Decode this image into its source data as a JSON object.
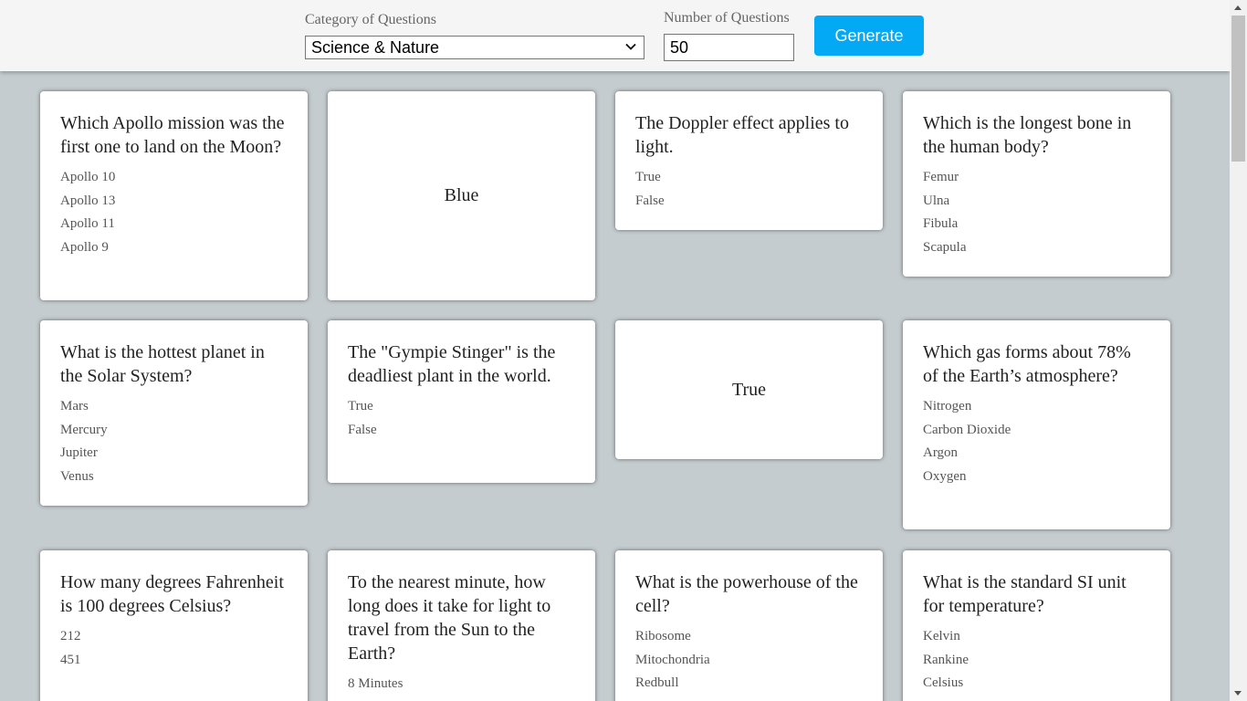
{
  "header": {
    "category_label": "Category of Questions",
    "category_value": "Science & Nature",
    "number_label": "Number of Questions",
    "number_value": "50",
    "generate_label": "Generate"
  },
  "cards": [
    {
      "question": "Which Apollo mission was the first one to land on the Moon?",
      "options": [
        "Apollo 10",
        "Apollo 13",
        "Apollo 11",
        "Apollo 9"
      ]
    },
    {
      "answer": "Blue"
    },
    {
      "question": "The Doppler effect applies to light.",
      "options": [
        "True",
        "False"
      ]
    },
    {
      "question": "Which is the longest bone in the human body?",
      "options": [
        "Femur",
        "Ulna",
        "Fibula",
        "Scapula"
      ]
    },
    {
      "question": "What is the hottest planet in the Solar System?",
      "options": [
        "Mars",
        "Mercury",
        "Jupiter",
        "Venus"
      ]
    },
    {
      "question": "The \"Gympie Stinger\" is the deadliest plant in the world.",
      "options": [
        "True",
        "False"
      ]
    },
    {
      "answer": "True"
    },
    {
      "question": "Which gas forms about 78% of the Earth’s atmosphere?",
      "options": [
        "Nitrogen",
        "Carbon Dioxide",
        "Argon",
        "Oxygen"
      ]
    },
    {
      "question": "How many degrees Fahrenheit is 100 degrees Celsius?",
      "options": [
        "212",
        "451"
      ]
    },
    {
      "question": "To the nearest minute, how long does it take for light to travel from the Sun to the Earth?",
      "options": [
        "8 Minutes"
      ]
    },
    {
      "question": "What is the powerhouse of the cell?",
      "options": [
        "Ribosome",
        "Mitochondria",
        "Redbull"
      ]
    },
    {
      "question": "What is the standard SI unit for temperature?",
      "options": [
        "Kelvin",
        "Rankine",
        "Celsius"
      ]
    }
  ]
}
